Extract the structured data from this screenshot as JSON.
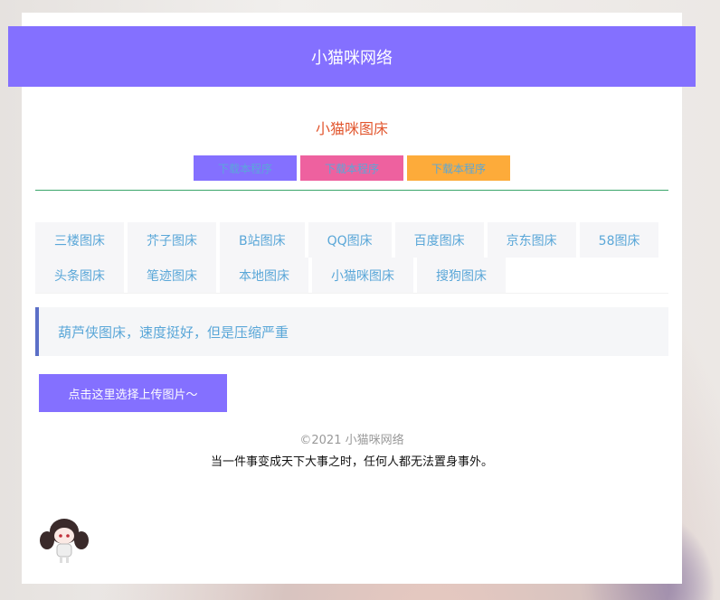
{
  "header": {
    "title": "小猫咪网络"
  },
  "main": {
    "subtitle": "小猫咪图床",
    "download_buttons": [
      {
        "label": "下载本程序",
        "color": "#8470ff"
      },
      {
        "label": "下载本程序",
        "color": "#ee619f"
      },
      {
        "label": "下载本程序",
        "color": "#fdab3a"
      }
    ],
    "tabs": [
      "三楼图床",
      "芥子图床",
      "B站图床",
      "QQ图床",
      "百度图床",
      "京东图床",
      "58图床",
      "头条图床",
      "笔迹图床",
      "本地图床",
      "小猫咪图床",
      "搜狗图床"
    ],
    "notice": "葫芦侠图床，速度挺好，但是压缩严重",
    "upload_label": "点击这里选择上传图片～"
  },
  "footer": {
    "copyright": "©2021 小猫咪网络",
    "motto": "当一件事变成天下大事之时，任何人都无法置身事外。"
  },
  "colors": {
    "accent": "#8470ff",
    "link": "#5aa7d8",
    "subtitle": "#e2572f"
  }
}
